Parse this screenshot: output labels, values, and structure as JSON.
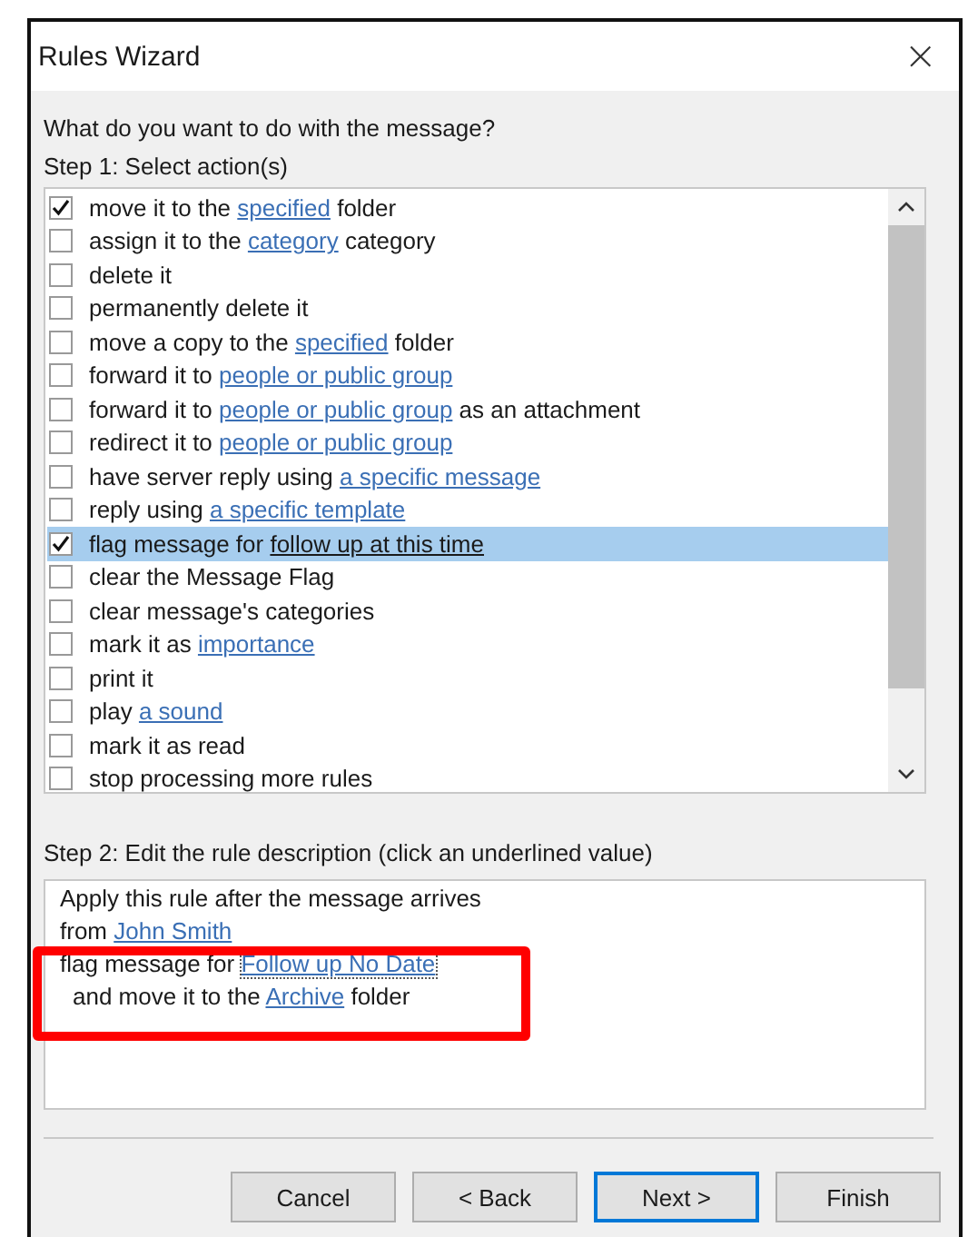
{
  "window": {
    "title": "Rules Wizard",
    "close": "×"
  },
  "question": "What do you want to do with the message?",
  "step1_label": "Step 1: Select action(s)",
  "actions": [
    {
      "checked": true,
      "selected": false,
      "parts": [
        {
          "text": "move it to the ",
          "kind": "text"
        },
        {
          "text": "specified",
          "kind": "link"
        },
        {
          "text": " folder",
          "kind": "text"
        }
      ]
    },
    {
      "checked": false,
      "selected": false,
      "parts": [
        {
          "text": "assign it to the ",
          "kind": "text"
        },
        {
          "text": "category",
          "kind": "link"
        },
        {
          "text": " category",
          "kind": "text"
        }
      ]
    },
    {
      "checked": false,
      "selected": false,
      "parts": [
        {
          "text": "delete it",
          "kind": "text"
        }
      ]
    },
    {
      "checked": false,
      "selected": false,
      "parts": [
        {
          "text": "permanently delete it",
          "kind": "text"
        }
      ]
    },
    {
      "checked": false,
      "selected": false,
      "parts": [
        {
          "text": "move a copy to the ",
          "kind": "text"
        },
        {
          "text": "specified",
          "kind": "link"
        },
        {
          "text": " folder",
          "kind": "text"
        }
      ]
    },
    {
      "checked": false,
      "selected": false,
      "parts": [
        {
          "text": "forward it to ",
          "kind": "text"
        },
        {
          "text": "people or public group",
          "kind": "link"
        }
      ]
    },
    {
      "checked": false,
      "selected": false,
      "parts": [
        {
          "text": "forward it to ",
          "kind": "text"
        },
        {
          "text": "people or public group",
          "kind": "link"
        },
        {
          "text": " as an attachment",
          "kind": "text"
        }
      ]
    },
    {
      "checked": false,
      "selected": false,
      "parts": [
        {
          "text": "redirect it to ",
          "kind": "text"
        },
        {
          "text": "people or public group",
          "kind": "link"
        }
      ]
    },
    {
      "checked": false,
      "selected": false,
      "parts": [
        {
          "text": "have server reply using ",
          "kind": "text"
        },
        {
          "text": "a specific message",
          "kind": "link"
        }
      ]
    },
    {
      "checked": false,
      "selected": false,
      "parts": [
        {
          "text": "reply using ",
          "kind": "text"
        },
        {
          "text": "a specific template",
          "kind": "link"
        }
      ]
    },
    {
      "checked": true,
      "selected": true,
      "parts": [
        {
          "text": "flag message for ",
          "kind": "text"
        },
        {
          "text": "follow up at this time",
          "kind": "link"
        }
      ]
    },
    {
      "checked": false,
      "selected": false,
      "parts": [
        {
          "text": "clear the Message Flag",
          "kind": "text"
        }
      ]
    },
    {
      "checked": false,
      "selected": false,
      "parts": [
        {
          "text": "clear message's categories",
          "kind": "text"
        }
      ]
    },
    {
      "checked": false,
      "selected": false,
      "parts": [
        {
          "text": "mark it as ",
          "kind": "text"
        },
        {
          "text": "importance",
          "kind": "link"
        }
      ]
    },
    {
      "checked": false,
      "selected": false,
      "parts": [
        {
          "text": "print it",
          "kind": "text"
        }
      ]
    },
    {
      "checked": false,
      "selected": false,
      "parts": [
        {
          "text": "play ",
          "kind": "text"
        },
        {
          "text": "a sound",
          "kind": "link"
        }
      ]
    },
    {
      "checked": false,
      "selected": false,
      "parts": [
        {
          "text": "mark it as read",
          "kind": "text"
        }
      ]
    },
    {
      "checked": false,
      "selected": false,
      "parts": [
        {
          "text": "stop processing more rules",
          "kind": "text"
        }
      ]
    }
  ],
  "step2_label": "Step 2: Edit the rule description (click an underlined value)",
  "description": [
    {
      "indent": false,
      "parts": [
        {
          "text": "Apply this rule after the message arrives",
          "kind": "text"
        }
      ]
    },
    {
      "indent": false,
      "parts": [
        {
          "text": "from ",
          "kind": "text"
        },
        {
          "text": "John Smith",
          "kind": "link"
        }
      ]
    },
    {
      "indent": false,
      "parts": [
        {
          "text": "flag message for ",
          "kind": "text"
        },
        {
          "text": "Follow up No Date",
          "kind": "link",
          "focused": true
        }
      ]
    },
    {
      "indent": true,
      "parts": [
        {
          "text": "and move it to the ",
          "kind": "text"
        },
        {
          "text": "Archive",
          "kind": "link"
        },
        {
          "text": " folder",
          "kind": "text"
        }
      ]
    }
  ],
  "buttons": [
    {
      "label": "Cancel",
      "default": false
    },
    {
      "label": "< Back",
      "default": false
    },
    {
      "label": "Next >",
      "default": true
    },
    {
      "label": "Finish",
      "default": false
    }
  ]
}
